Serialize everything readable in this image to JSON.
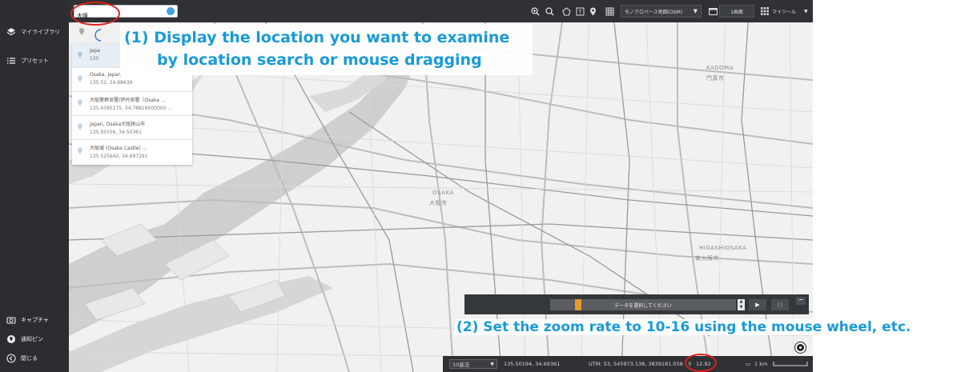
{
  "sidebar": {
    "items": [
      {
        "label": "マイライブラリ",
        "icon": "layers-icon"
      },
      {
        "label": "プリセット",
        "icon": "list-icon"
      }
    ],
    "bottom_items": [
      {
        "label": "キャプチャ",
        "icon": "camera-icon"
      },
      {
        "label": "通知ピン",
        "icon": "pin-icon"
      },
      {
        "label": "閉じる",
        "icon": "close-circle-icon"
      }
    ]
  },
  "search": {
    "value": "大阪",
    "placeholder": ""
  },
  "results": [
    {
      "name": "Japa",
      "coord": "135"
    },
    {
      "name": "Osaka, Japan",
      "coord": "135.52, 34.68639"
    },
    {
      "name": "大阪警察宮署(伊丹宮署（Osaka ...",
      "coord": "135.4395175, 34.78816000000 ..."
    },
    {
      "name": "Japan, Osaka大阪狭山市",
      "coord": "135.55556, 34.50361"
    },
    {
      "name": "大阪城 (Osaka Castle) ...",
      "coord": "135.525642, 34.687291"
    }
  ],
  "toolbar": {
    "basemap": "モノクロベース地図(OSM)",
    "screen": "1画面",
    "mytool": "マイツール"
  },
  "annotations": {
    "step1_line1": "(1)  Display the location you want to examine",
    "step1_line2": "by location search or mouse dragging",
    "step2": "(2) Set the zoom rate to 10-16 using the mouse wheel, etc."
  },
  "map_labels": {
    "kadoma": "KADOMA",
    "kadoma_jp": "門真市",
    "osaka": "OSAKA",
    "osaka_jp": "大阪市",
    "higashiosaka": "HIGASHIOSAKA",
    "higashiosaka_jp": "東大阪市"
  },
  "timebar": {
    "data_select": "データを選択してください",
    "play": "▶",
    "pause": "| |",
    "collapse": "−"
  },
  "status": {
    "coord_format": "10進法",
    "lonlat": "135.50194, 34.69361",
    "utm": "UTM: 53, 545973.138, 3839181.058",
    "zoom": "12.92",
    "scale": "1 km"
  },
  "colors": {
    "accent_text": "#1a9ad6",
    "highlight_ring": "#e0201c",
    "sidebar_bg": "#2b2d30",
    "timeline_marker": "#e79a2b"
  }
}
